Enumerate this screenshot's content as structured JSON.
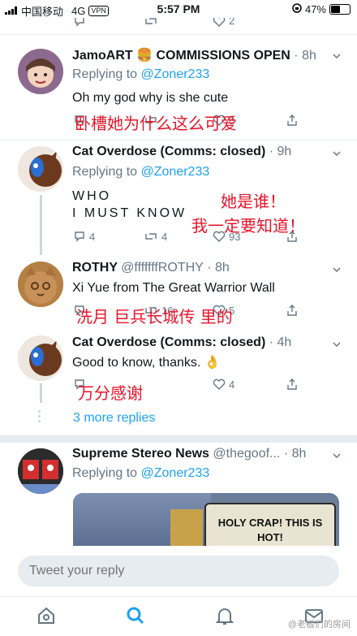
{
  "status": {
    "carrier": "中国移动",
    "network": "4G",
    "vpn": "VPN",
    "time": "5:57 PM",
    "battery": "47%"
  },
  "top_actions": {
    "like_count": "2"
  },
  "tweets": [
    {
      "name": "JamoART 🍔 COMMISSIONS OPEN",
      "time": "· 8h",
      "replying_prefix": "Replying to ",
      "replying_to": "@Zoner233",
      "text": "Oh my god why is she cute",
      "like_count": "8",
      "overlay": "卧槽她为什么这么可爱"
    },
    {
      "name": "Cat Overdose (Comms: closed)",
      "time": "· 9h",
      "replying_prefix": "Replying to ",
      "replying_to": "@Zoner233",
      "text_line1": "WHO",
      "text_line2": "I MUST KNOW",
      "reply_count": "4",
      "retweet_count": "4",
      "like_count": "93",
      "overlay1": "她是谁！",
      "overlay2": "我一定要知道！"
    },
    {
      "name": "ROTHY",
      "handle": "@fffffffROTHY",
      "time": "· 8h",
      "text": "Xi Yue from The Great Warrior Wall",
      "retweet_count": "16",
      "like_count": "5",
      "overlay": "洗月 巨兵长城传 里的"
    },
    {
      "name": "Cat Overdose (Comms: closed)",
      "time": "· 4h",
      "text": "Good to know, thanks.  👌",
      "like_count": "4",
      "overlay": "万分感谢"
    },
    {
      "name": "Supreme Stereo News",
      "handle": "@thegoof...",
      "time": "· 8h",
      "replying_prefix": "Replying to ",
      "replying_to": "@Zoner233",
      "media_text": "HOLY CRAP! THIS IS HOT!"
    }
  ],
  "more_replies": "3 more replies",
  "reply_box": {
    "placeholder": "Tweet your reply"
  },
  "watermark": "@老板们的房间",
  "colors": {
    "accent": "#1da1f2",
    "overlay_red": "#e8142a",
    "muted": "#657786"
  }
}
